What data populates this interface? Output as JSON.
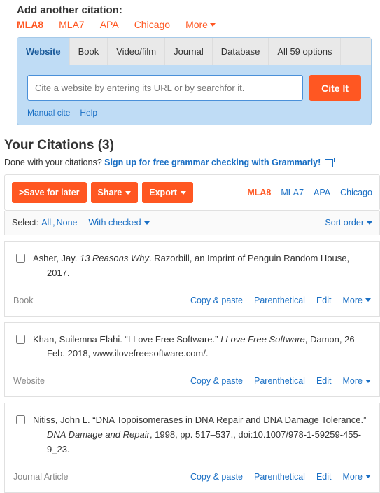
{
  "add": {
    "title": "Add another citation:",
    "styles": [
      "MLA8",
      "MLA7",
      "APA",
      "Chicago",
      "More"
    ],
    "active_style": "MLA8",
    "source_tabs": [
      "Website",
      "Book",
      "Video/film",
      "Journal",
      "Database",
      "All 59 options"
    ],
    "active_source": "Website",
    "placeholder": "Cite a website by entering its URL or by searchfor it.",
    "cite_btn": "Cite It",
    "manual": "Manual cite",
    "help": "Help"
  },
  "your": {
    "heading": "Your Citations (3)",
    "done_prefix": "Done with your citations? ",
    "done_link": "Sign up for free grammar checking with Grammarly!",
    "save_btn": ">Save for later",
    "share_btn": "Share",
    "export_btn": "Export",
    "styles": [
      "MLA8",
      "MLA7",
      "APA",
      "Chicago"
    ],
    "active_style": "MLA8",
    "select_lbl": "Select:",
    "all": "All",
    "none": "None",
    "with_checked": "With checked",
    "sort": "Sort order"
  },
  "citations": [
    {
      "pre": "Asher, Jay. ",
      "italic": "13 Reasons Why",
      "post": ". Razorbill, an Imprint of Penguin Random House, 2017.",
      "type": "Book"
    },
    {
      "pre": "Khan, Suilemna Elahi. “I Love Free Software.” ",
      "italic": "I Love Free Software",
      "post": ", Damon, 26 Feb. 2018, www.ilovefreesoftware.com/.",
      "type": "Website"
    },
    {
      "pre": "Nitiss, John L. “DNA Topoisomerases in DNA Repair and DNA Damage Tolerance.” ",
      "italic": "DNA Damage and Repair",
      "post": ", 1998, pp. 517–537., doi:10.1007/978-1-59259-455-9_23.",
      "type": "Journal Article"
    }
  ],
  "actions": {
    "copy": "Copy & paste",
    "paren": "Parenthetical",
    "edit": "Edit",
    "more": "More"
  }
}
